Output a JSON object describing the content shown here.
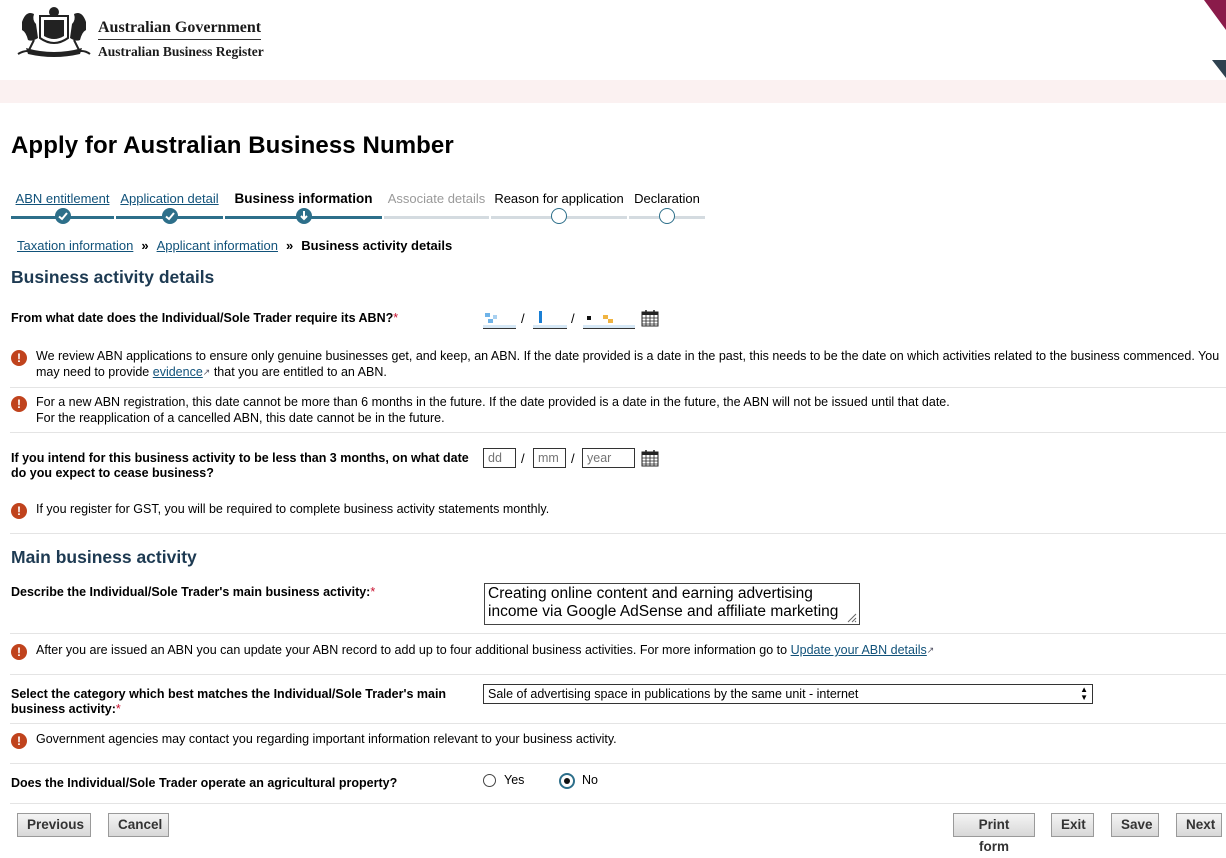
{
  "header": {
    "government": "Australian Government",
    "register": "Australian Business Register"
  },
  "page_title": "Apply for Australian Business Number",
  "steps": [
    {
      "label": "ABN entitlement",
      "state": "done"
    },
    {
      "label": "Application detail",
      "state": "done"
    },
    {
      "label": "Business information",
      "state": "current"
    },
    {
      "label": "Associate details",
      "state": "disabled"
    },
    {
      "label": "Reason for application",
      "state": "todo"
    },
    {
      "label": "Declaration",
      "state": "todo"
    }
  ],
  "breadcrumb": {
    "items": [
      "Taxation information",
      "Applicant information"
    ],
    "separator": "»",
    "current": "Business activity details"
  },
  "business_activity": {
    "heading": "Business activity details",
    "start_date_question": "From what date does the Individual/Sole Trader require its ABN?",
    "required_marker": "*",
    "note1_part1": "We review ABN applications to ensure only genuine businesses get, and keep, an ABN. If the date provided is a date in the past, this needs to be the date on which activities related to the business commenced. You may need to provide ",
    "note1_link": "evidence",
    "note1_part2": " that you are entitled to an ABN.",
    "note2_line1": "For a new ABN registration, this date cannot be more than 6 months in the future. If the date provided is a date in the future, the ABN will not be issued until that date.",
    "note2_line2": "For the reapplication of a cancelled ABN, this date cannot be in the future.",
    "cease_question": "If you intend for this business activity to be less than 3 months, on what date do you expect to cease business?",
    "cease_placeholders": {
      "day": "dd",
      "month": "mm",
      "year": "year"
    },
    "date_separator": "/",
    "gst_note": "If you register for GST, you will be required to complete business activity statements monthly."
  },
  "main_activity": {
    "heading": "Main business activity",
    "describe_question": "Describe the Individual/Sole Trader's main business activity:",
    "description_value": "Creating online content and earning advertising income via Google AdSense and affiliate marketing",
    "update_note": "After you are issued an ABN you can update your ABN record to add up to four additional business activities. For more information go to ",
    "update_link": "Update your ABN details",
    "category_question": "Select the category which best matches the Individual/Sole Trader's main business activity:",
    "category_value": "Sale of advertising space in publications by the same unit - internet",
    "contact_note": "Government agencies may contact you regarding important information relevant to your business activity.",
    "agri_question": "Does the Individual/Sole Trader operate an agricultural property?",
    "agri_yes": "Yes",
    "agri_no": "No",
    "agri_selected": "No"
  },
  "buttons": {
    "previous": "Previous",
    "cancel": "Cancel",
    "print": "Print form",
    "exit": "Exit",
    "save": "Save",
    "next": "Next"
  },
  "icons": {
    "warning": "exclamation-circle-icon",
    "calendar": "calendar-icon",
    "external": "external-link-icon"
  },
  "colors": {
    "accent": "#2d6f8a",
    "link": "#11527a",
    "warning": "#c0431d",
    "required": "#c8102e",
    "band": "#fbf1f1"
  }
}
